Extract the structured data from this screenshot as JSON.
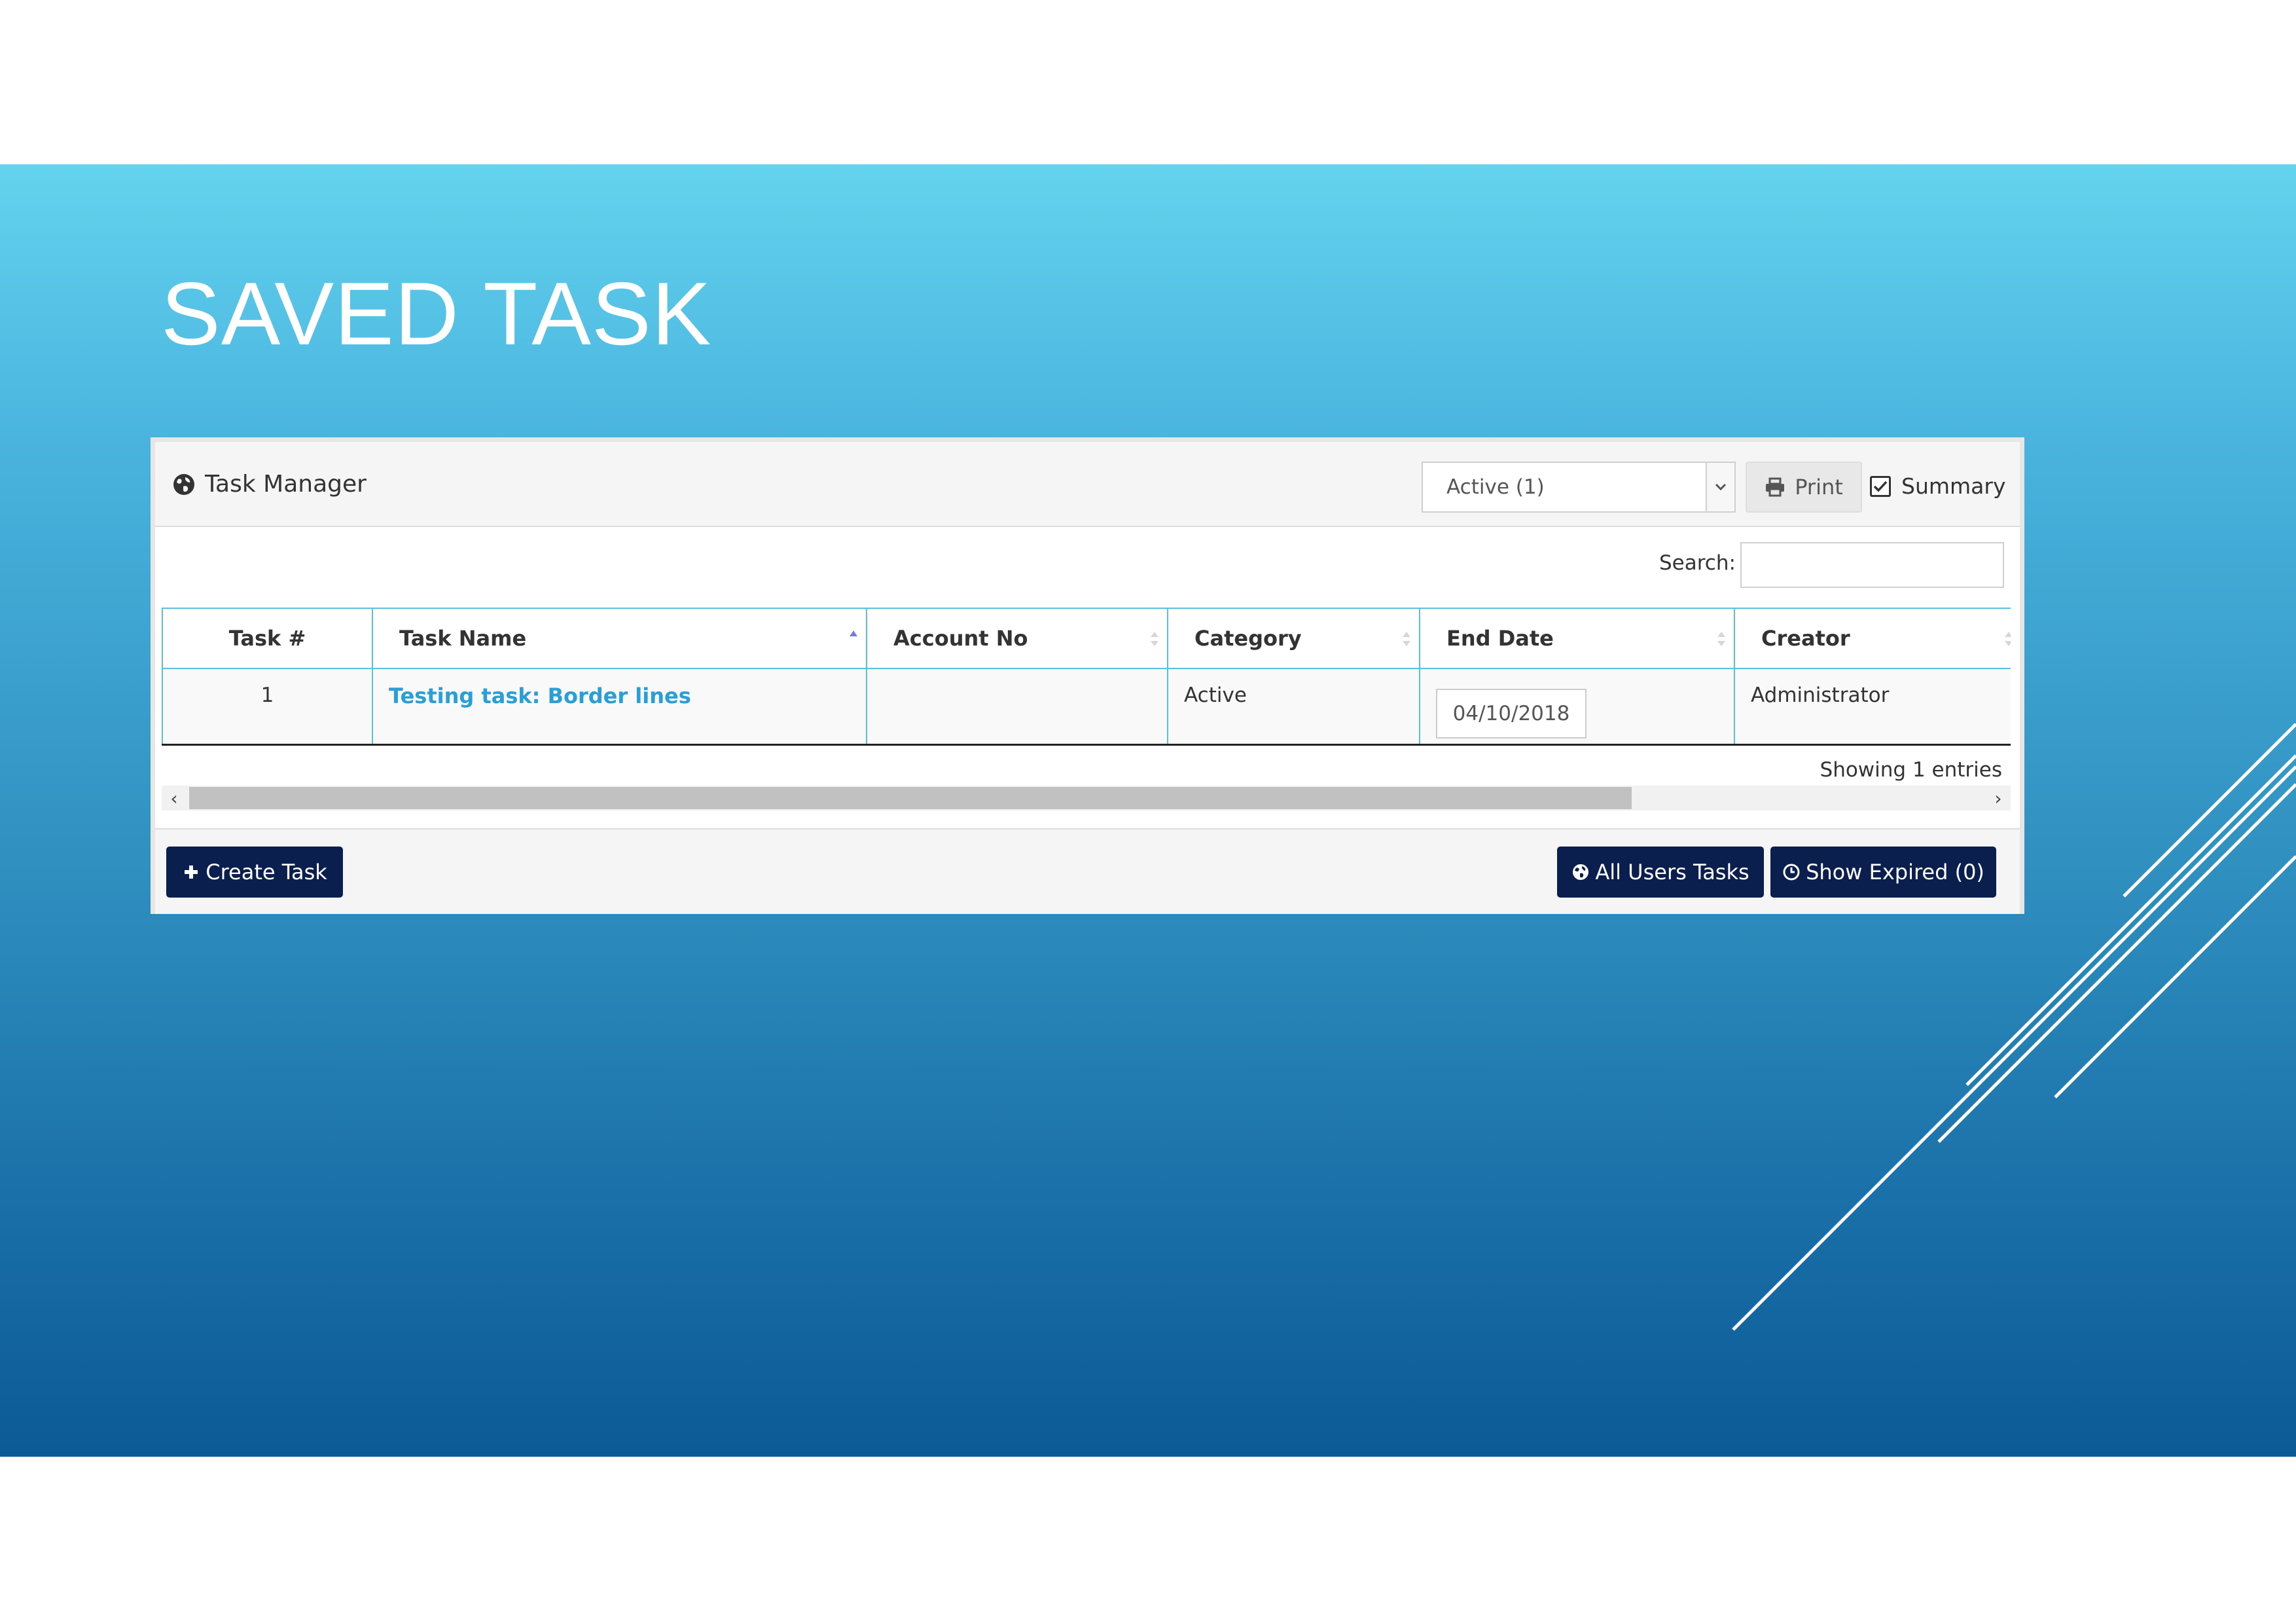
{
  "slide": {
    "title": "SAVED TASK"
  },
  "panel": {
    "title": "Task Manager",
    "status_filter": "Active (1)",
    "print_label": "Print",
    "summary_label": "Summary",
    "summary_checked": true,
    "search_label": "Search:",
    "search_value": ""
  },
  "table": {
    "headers": [
      "Task #",
      "Task Name",
      "Account No",
      "Category",
      "End Date",
      "Creator"
    ],
    "rows": [
      {
        "task_no": "1",
        "task_name": "Testing task: Border lines",
        "account_no": "",
        "category": "Active",
        "end_date": "04/10/2018",
        "creator": "Administrator"
      }
    ],
    "info": "Showing 1 entries"
  },
  "footer": {
    "create_label": "Create Task",
    "all_users_label": "All Users Tasks",
    "show_expired_label": "Show Expired (0)"
  },
  "colors": {
    "accent_link": "#2a9fd6",
    "table_border": "#5bc0de",
    "dark_button": "#0b1f4f"
  }
}
